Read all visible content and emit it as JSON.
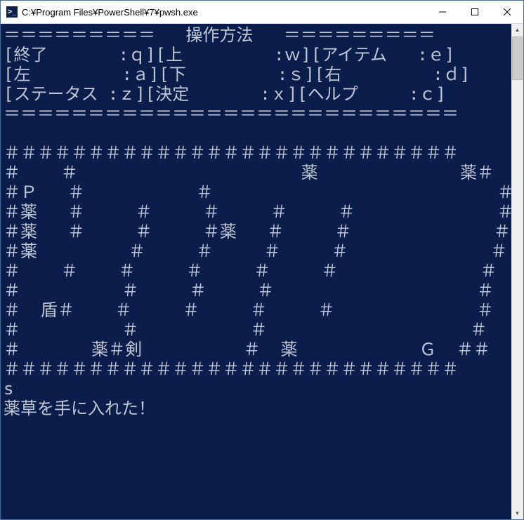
{
  "window": {
    "title": "C:¥Program Files¥PowerShell¥7¥pwsh.exe"
  },
  "controls_header": {
    "divider": "＝＝＝＝＝＝＝＝＝   操作方法   ＝＝＝＝＝＝＝＝＝",
    "rows": [
      "[終了       :ｑ][上         :ｗ][アイテム   :ｅ]",
      "[左         :ａ][下         :ｓ][右         :ｄ]",
      "[ステータス :ｚ][決定       :ｘ][ヘルプ     :ｃ]"
    ],
    "bottom_divider": "＝＝＝＝＝＝＝＝＝＝＝＝＝＝＝＝＝＝＝＝＝＝＝＝＝＝＝"
  },
  "map": {
    "legend": {
      "wall": "＃",
      "player": "Ｐ",
      "goal": "Ｇ",
      "potion": "薬",
      "shield": "盾",
      "sword": "剣"
    },
    "rows": [
      "＃＃＃＃＃＃＃＃＃＃＃＃＃＃＃＃＃＃＃＃＃＃＃＃＃＃＃",
      "＃    ＃                      薬              薬＃",
      "＃Ｐ   ＃           ＃                            ＃",
      "＃薬   ＃     ＃     ＃     ＃     ＃              ＃",
      "＃薬   ＃     ＃     ＃薬   ＃     ＃              ＃",
      "＃薬         ＃     ＃     ＃     ＃              ＃",
      "＃    ＃    ＃     ＃     ＃     ＃              ＃",
      "＃          ＃     ＃     ＃                    ＃",
      "＃  盾＃    ＃     ＃     ＃     ＃              ＃",
      "＃          ＃           ＃                    ＃",
      "＃       薬＃剣          ＃  薬            Ｇ  ＃＃",
      "＃＃＃＃＃＃＃＃＃＃＃＃＃＃＃＃＃＃＃＃＃＃＃＃＃＃＃"
    ]
  },
  "log": {
    "last_input": "s",
    "message": "薬草を手に入れた！"
  }
}
